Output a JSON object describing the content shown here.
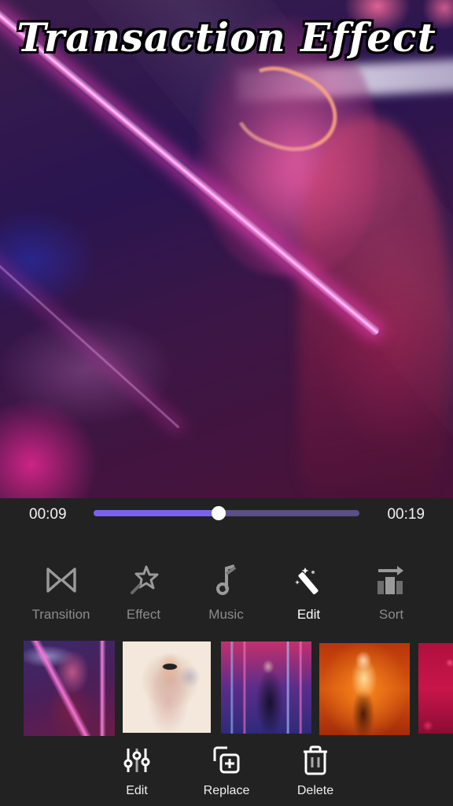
{
  "preview": {
    "title": "Transaction Effect"
  },
  "player": {
    "current_time": "00:09",
    "duration": "00:19",
    "progress": 0.47,
    "colors": {
      "fill": "#7a63e8",
      "track": "#5a4f86",
      "knob": "#ffffff"
    }
  },
  "tools": [
    {
      "label": "Transition",
      "icon": "transition-icon",
      "active": false
    },
    {
      "label": "Effect",
      "icon": "magic-star-icon",
      "active": false
    },
    {
      "label": "Music",
      "icon": "music-note-icon",
      "active": false
    },
    {
      "label": "Edit",
      "icon": "magic-wand-icon",
      "active": true
    },
    {
      "label": "Sort",
      "icon": "sort-icon",
      "active": false
    }
  ],
  "thumbnails": [
    {
      "name": "neon-portrait"
    },
    {
      "name": "watercolor-portrait"
    },
    {
      "name": "neon-lights-portrait"
    },
    {
      "name": "fire-portrait"
    },
    {
      "name": "red-hearts"
    }
  ],
  "actions": [
    {
      "label": "Edit",
      "icon": "sliders-icon"
    },
    {
      "label": "Replace",
      "icon": "replace-icon"
    },
    {
      "label": "Delete",
      "icon": "trash-icon"
    }
  ],
  "theme": {
    "background": "#222222",
    "inactive_text": "#8c8c8c",
    "active_text": "#ffffff"
  }
}
